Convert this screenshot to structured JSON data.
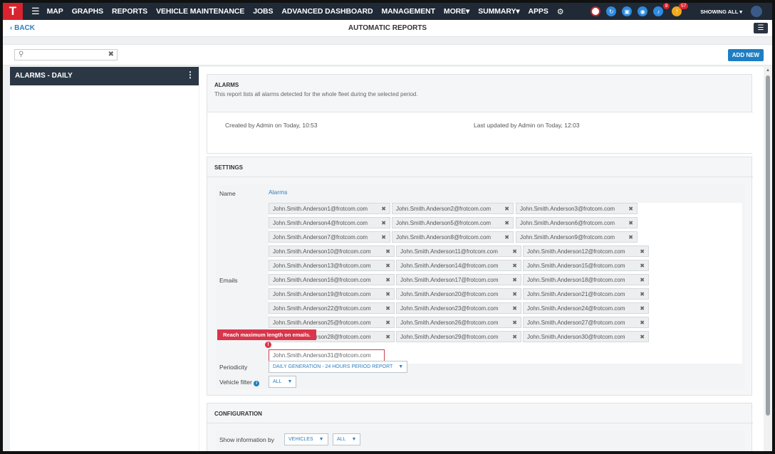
{
  "nav": {
    "logo": "T",
    "items": [
      "MAP",
      "GRAPHS",
      "REPORTS",
      "VEHICLE MAINTENANCE",
      "JOBS",
      "ADVANCED DASHBOARD",
      "MANAGEMENT",
      "MORE▾",
      "SUMMARY▾",
      "APPS"
    ],
    "badges": {
      "notifications": "9",
      "alerts": "57"
    },
    "showing": "SHOWING  ALL  ▾"
  },
  "subheader": {
    "back": "‹ BACK",
    "title": "AUTOMATIC REPORTS"
  },
  "toolbar": {
    "search_value": "",
    "add_new": "ADD NEW"
  },
  "list": {
    "items": [
      {
        "label": "ALARMS - DAILY"
      }
    ]
  },
  "report": {
    "title": "ALARMS",
    "description": "This report lists all alarms detected for the whole fleet during the selected period.",
    "created": "Created by Admin on Today, 10:53",
    "updated": "Last updated by Admin on Today, 12:03"
  },
  "settings": {
    "heading": "SETTINGS",
    "name_label": "Name",
    "name_value": "Alarms",
    "emails_label": "Emails",
    "emails": [
      "John.Smith.Anderson1@frotcom.com",
      "John.Smith.Anderson2@frotcom.com",
      "John.Smith.Anderson3@frotcom.com",
      "John.Smith.Anderson4@frotcom.com",
      "John.Smith.Anderson5@frotcom.com",
      "John.Smith.Anderson6@frotcom.com",
      "John.Smith.Anderson7@frotcom.com",
      "John.Smith.Anderson8@frotcom.com",
      "John.Smith.Anderson9@frotcom.com",
      "John.Smith.Anderson10@frotcom.com",
      "John.Smith.Anderson11@frotcom.com",
      "John.Smith.Anderson12@frotcom.com",
      "John.Smith.Anderson13@frotcom.com",
      "John.Smith.Anderson14@frotcom.com",
      "John.Smith.Anderson15@frotcom.com",
      "John.Smith.Anderson16@frotcom.com",
      "John.Smith.Anderson17@frotcom.com",
      "John.Smith.Anderson18@frotcom.com",
      "John.Smith.Anderson19@frotcom.com",
      "John.Smith.Anderson20@frotcom.com",
      "John.Smith.Anderson21@frotcom.com",
      "John.Smith.Anderson22@frotcom.com",
      "John.Smith.Anderson23@frotcom.com",
      "John.Smith.Anderson24@frotcom.com",
      "John.Smith.Anderson25@frotcom.com",
      "John.Smith.Anderson26@frotcom.com",
      "John.Smith.Anderson27@frotcom.com",
      "John.Smith.Anderson28@frotcom.com",
      "John.Smith.Anderson29@frotcom.com",
      "John.Smith.Anderson30@frotcom.com"
    ],
    "email_input_value": "John.Smith.Anderson31@frotcom.com",
    "error_tooltip": "Reach maximum length on emails.",
    "periodicity_label": "Periodicity",
    "periodicity_value": "DAILY GENERATION - 24 HOURS PERIOD REPORT",
    "vehicle_filter_label": "Vehicle filter",
    "vehicle_filter_value": "ALL"
  },
  "configuration": {
    "heading": "CONFIGURATION",
    "show_info_label": "Show information by",
    "show_info_value": "VEHICLES",
    "show_info_filter": "ALL"
  },
  "colors": {
    "nav_bg": "#1f2a36",
    "brand_red": "#d9232e",
    "accent_blue": "#1d7ec3",
    "error_red": "#d9354b"
  }
}
